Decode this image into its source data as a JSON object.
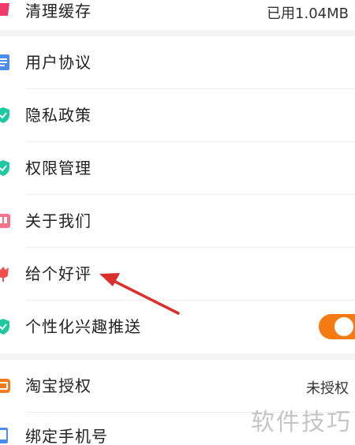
{
  "settings": {
    "top_group": {
      "clear_cache": {
        "label": "清理缓存",
        "value": "已用1.04MB"
      }
    },
    "items": [
      {
        "label": "用户协议"
      },
      {
        "label": "隐私政策"
      },
      {
        "label": "权限管理"
      },
      {
        "label": "关于我们"
      },
      {
        "label": "给个好评"
      },
      {
        "label": "个性化兴趣推送"
      }
    ],
    "bottom_group": {
      "taobao_auth": {
        "label": "淘宝授权",
        "value": "未授权"
      },
      "bind_phone": {
        "label": "绑定手机号"
      }
    },
    "personalized_push_enabled": true
  },
  "watermark": "软件技巧",
  "colors": {
    "accent": "#f47a11",
    "annotation_arrow": "#d9302b",
    "shield_icon": "#1fc8a0"
  }
}
